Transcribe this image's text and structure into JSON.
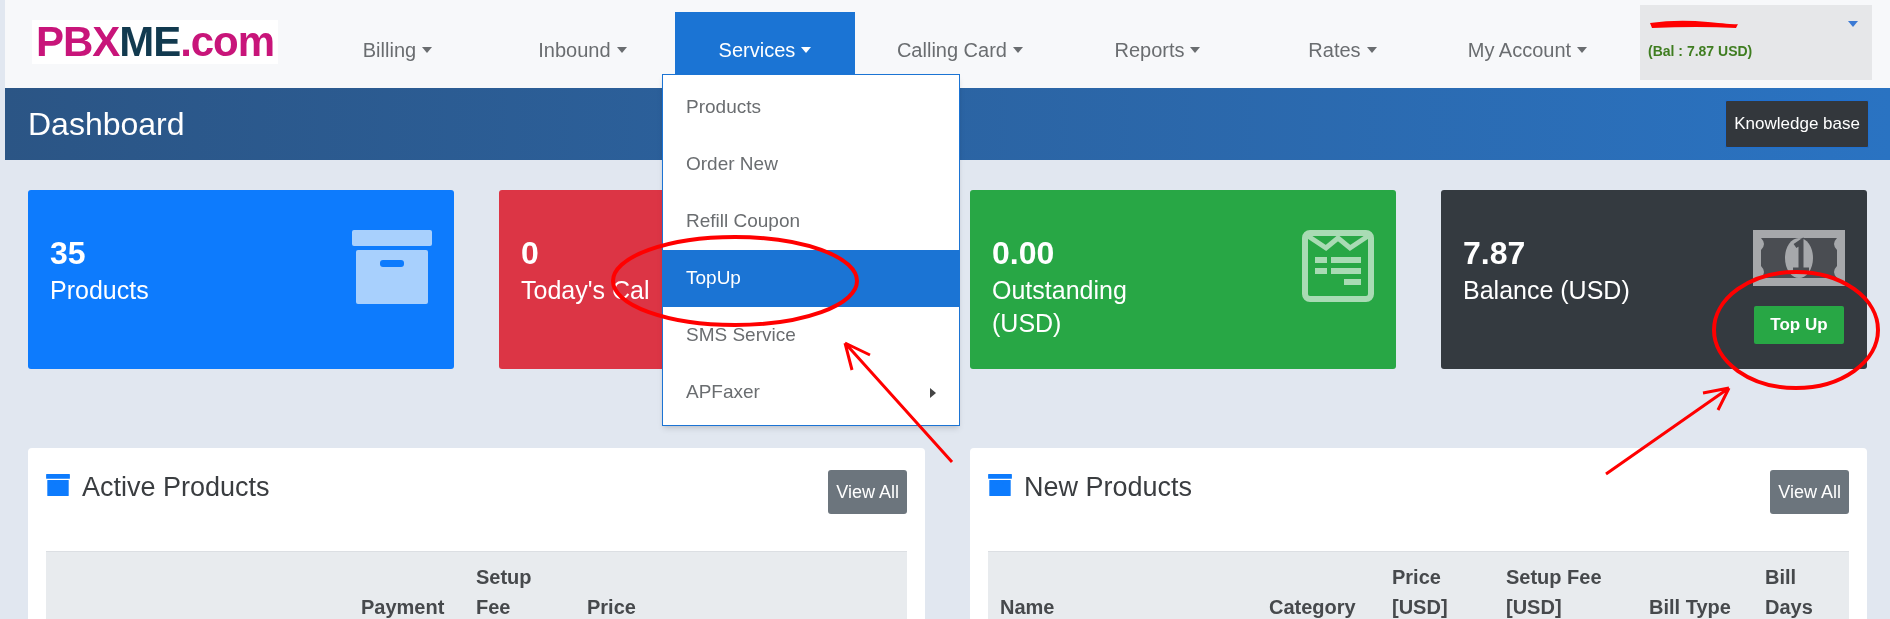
{
  "logo": [
    {
      "text": "PBX",
      "kind": "accent"
    },
    {
      "text": "ME",
      "kind": "dark"
    },
    {
      "text": ".com",
      "kind": "accent"
    }
  ],
  "nav": [
    {
      "label": "Billing",
      "selected": false
    },
    {
      "label": "Inbound",
      "selected": false
    },
    {
      "label": "Services",
      "selected": true
    },
    {
      "label": "Calling Card",
      "selected": false
    },
    {
      "label": "Reports",
      "selected": false
    },
    {
      "label": "Rates",
      "selected": false
    },
    {
      "label": "My Account",
      "selected": false
    }
  ],
  "account": {
    "balance": "(Bal : 7.87 USD)"
  },
  "header": {
    "title": "Dashboard",
    "button": "Knowledge base"
  },
  "dropdown": [
    {
      "label": "Products",
      "selected": false,
      "submenu": false
    },
    {
      "label": "Order New",
      "selected": false,
      "submenu": false
    },
    {
      "label": "Refill Coupon",
      "selected": false,
      "submenu": false
    },
    {
      "label": "TopUp",
      "selected": true,
      "submenu": false
    },
    {
      "label": "SMS Service",
      "selected": false,
      "submenu": false
    },
    {
      "label": "APFaxer",
      "selected": false,
      "submenu": true
    }
  ],
  "cards": [
    {
      "value": "35",
      "label": "Products",
      "color": "#0d7bfd",
      "kind": "box"
    },
    {
      "value": "0",
      "label": "Today's Cal",
      "color": "#dc3545"
    },
    {
      "value": "0.00",
      "label": "Outstanding (USD)",
      "color": "#28a745",
      "kind": "invoice"
    },
    {
      "value": "7.87",
      "label": "Balance (USD)",
      "color": "#343a40",
      "kind": "banknote",
      "button": "Top Up"
    }
  ],
  "panels": [
    {
      "kind": "active",
      "title": "Active Products",
      "button": "View All",
      "columns": [
        "Payment",
        "Setup Fee",
        "Price"
      ]
    },
    {
      "kind": "new",
      "title": "New Products",
      "button": "View All",
      "columns": [
        "Name",
        "Category",
        "Price [USD]",
        "Setup Fee [USD]",
        "Bill Type",
        "Bill Days"
      ]
    }
  ]
}
